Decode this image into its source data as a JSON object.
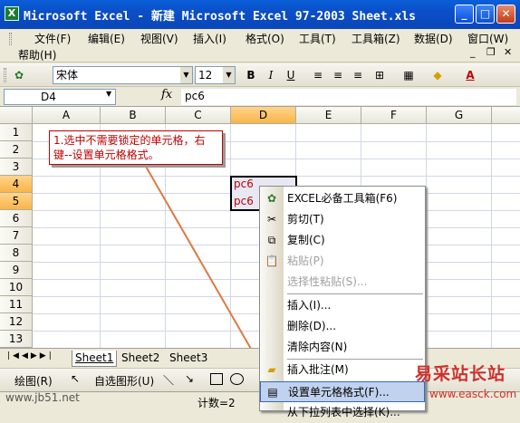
{
  "window": {
    "title": "Microsoft Excel - 新建 Microsoft Excel 97-2003 Sheet.xls",
    "app_icon": "X"
  },
  "menu": {
    "items": [
      "文件(F)",
      "编辑(E)",
      "视图(V)",
      "插入(I)",
      "格式(O)",
      "工具(T)",
      "工具箱(Z)",
      "数据(D)",
      "窗口(W)"
    ],
    "help": "帮助(H)"
  },
  "toolbar": {
    "font_name": "宋体",
    "font_size": "12",
    "bold": "B",
    "italic": "I",
    "underline": "U",
    "font_color_letter": "A"
  },
  "formula_bar": {
    "name_box": "D4",
    "fx": "fx",
    "content": "pc6"
  },
  "grid": {
    "columns": [
      "A",
      "B",
      "C",
      "D",
      "E",
      "F",
      "G"
    ],
    "rows": [
      "1",
      "2",
      "3",
      "4",
      "5",
      "6",
      "7",
      "8",
      "9",
      "10",
      "11",
      "12",
      "13"
    ],
    "selected_column": "D",
    "cells": {
      "D4": "pc6",
      "D5": "pc6"
    }
  },
  "callout": {
    "text": "1.选中不需要锁定的单元格，右键--设置单元格格式。"
  },
  "sheets": [
    "Sheet1",
    "Sheet2",
    "Sheet3"
  ],
  "active_sheet": "Sheet1",
  "drawing_toolbar": {
    "draw": "绘图(R)",
    "autoshapes": "自选图形(U)"
  },
  "status": {
    "count": "计数=2"
  },
  "context_menu": {
    "items": [
      {
        "label": "EXCEL必备工具箱(F6)",
        "enabled": true
      },
      {
        "label": "剪切(T)",
        "enabled": true
      },
      {
        "label": "复制(C)",
        "enabled": true
      },
      {
        "label": "粘贴(P)",
        "enabled": false
      },
      {
        "label": "选择性粘贴(S)...",
        "enabled": false
      },
      {
        "label": "插入(I)...",
        "enabled": true
      },
      {
        "label": "删除(D)...",
        "enabled": true
      },
      {
        "label": "清除内容(N)",
        "enabled": true
      },
      {
        "label": "插入批注(M)",
        "enabled": true
      },
      {
        "label": "设置单元格格式(F)...",
        "enabled": true,
        "highlighted": true
      },
      {
        "label": "从下拉列表中选择(K)...",
        "enabled": true
      }
    ]
  },
  "watermark": {
    "site_name": "易采站长站",
    "site_url": "www.easck.com",
    "jb51": "www.jb51.net"
  },
  "colors": {
    "title_bar": "#0a4fc8",
    "selected_header": "#f8b54a",
    "menu_highlight": "#c1d2ee",
    "annotation": "#c00000"
  }
}
